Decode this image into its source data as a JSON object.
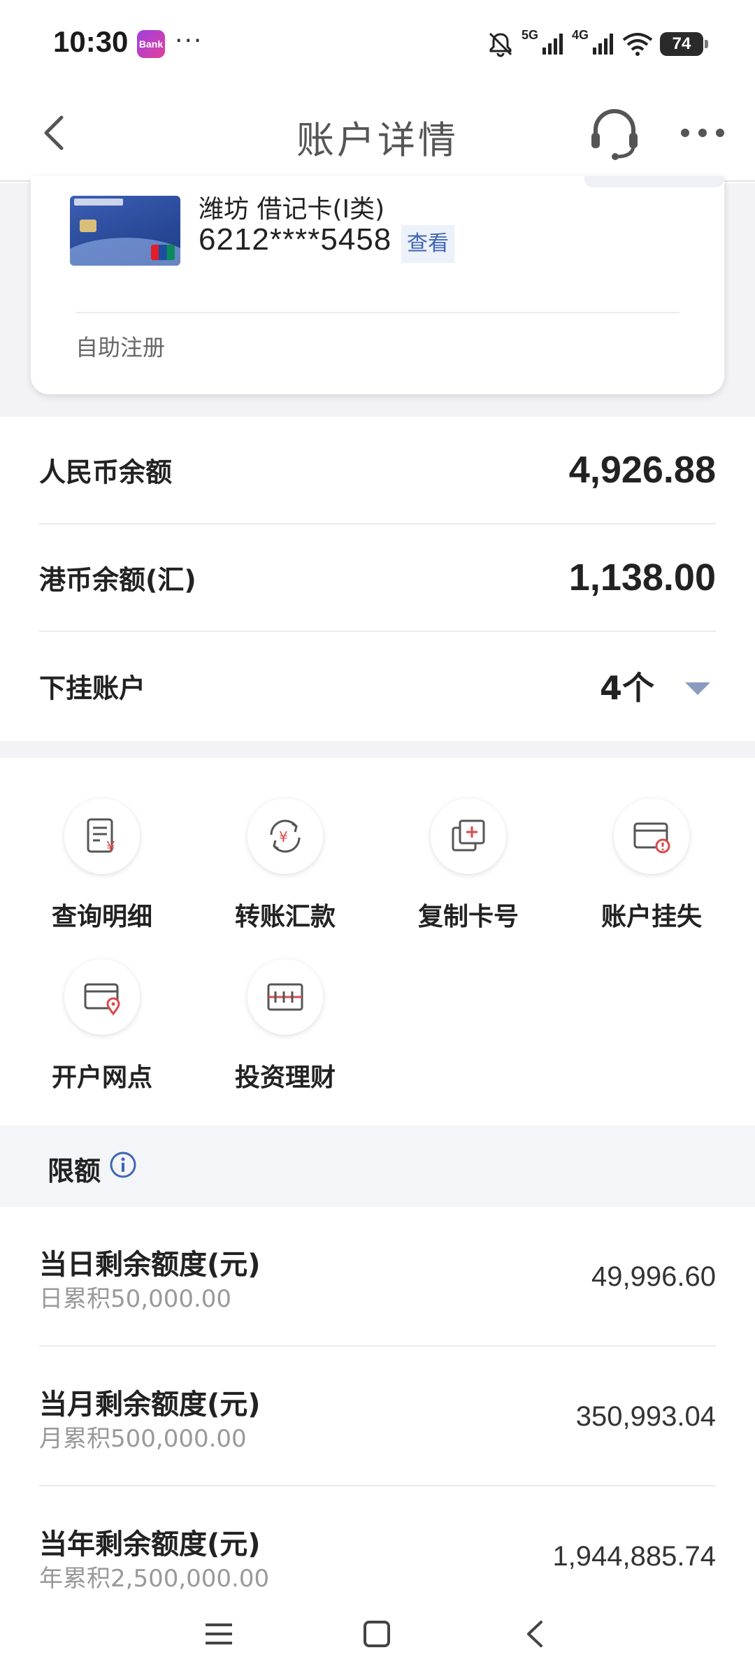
{
  "status_bar": {
    "time": "10:30",
    "app_icon_text": "Bank",
    "dots": "···",
    "net_5g": "5G",
    "net_4g": "4G",
    "battery": "74"
  },
  "header": {
    "title": "账户详情"
  },
  "card": {
    "name": "潍坊 借记卡(I类)",
    "number": "6212****5458",
    "view_label": "查看",
    "register_label": "自助注册"
  },
  "balances": {
    "rmb_label": "人民币余额",
    "rmb_value": "4,926.88",
    "hkd_label": "港币余额(汇)",
    "hkd_value": "1,138.00",
    "sub_accounts_label": "下挂账户",
    "sub_accounts_value": "4个"
  },
  "actions": [
    {
      "label": "查询明细",
      "icon": "statement-icon"
    },
    {
      "label": "转账汇款",
      "icon": "transfer-icon"
    },
    {
      "label": "复制卡号",
      "icon": "copy-icon"
    },
    {
      "label": "账户挂失",
      "icon": "report-loss-icon"
    },
    {
      "label": "开户网点",
      "icon": "branch-location-icon"
    },
    {
      "label": "投资理财",
      "icon": "investment-icon"
    }
  ],
  "limits": {
    "title": "限额",
    "rows": [
      {
        "label": "当日剩余额度(元)",
        "sub": "日累积50,000.00",
        "value": "49,996.60"
      },
      {
        "label": "当月剩余额度(元)",
        "sub": "月累积500,000.00",
        "value": "350,993.04"
      },
      {
        "label": "当年剩余额度(元)",
        "sub": "年累积2,500,000.00",
        "value": "1,944,885.74"
      }
    ]
  },
  "colors": {
    "accent_blue": "#3e66b5",
    "icon_red": "#d94a4a",
    "icon_gray": "#555555"
  }
}
